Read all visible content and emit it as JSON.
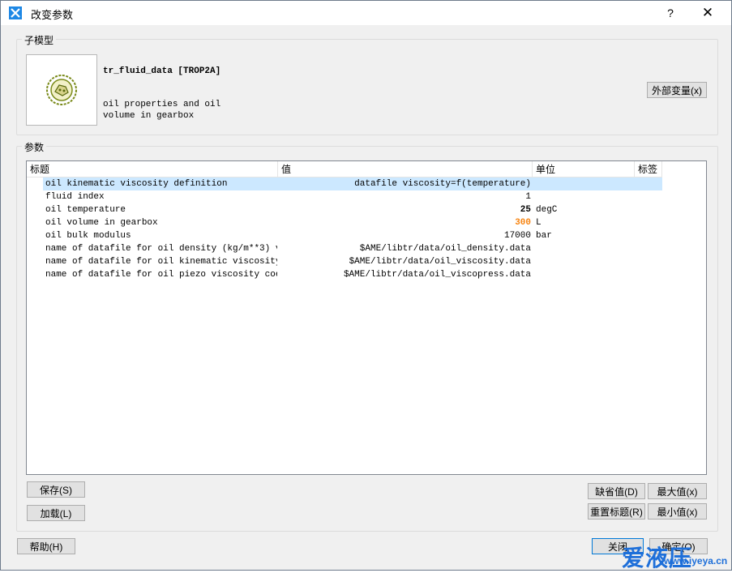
{
  "window": {
    "title": "改变参数",
    "help_glyph": "?",
    "close_glyph": "✕"
  },
  "submodel": {
    "group_label": "子模型",
    "name": "tr_fluid_data [TROP2A]",
    "description_line1": "oil properties and oil",
    "description_line2": "volume in gearbox",
    "external_vars_button": "外部变量(x)"
  },
  "params": {
    "group_label": "参数",
    "columns": [
      "标题",
      "值",
      "单位",
      "标签"
    ],
    "rows": [
      {
        "title": "oil kinematic viscosity definition",
        "value": "datafile viscosity=f(temperature)",
        "unit": ""
      },
      {
        "title": "fluid index",
        "value": "1",
        "unit": ""
      },
      {
        "title": "oil temperature",
        "value": "25",
        "unit": "degC"
      },
      {
        "title": "oil volume in gearbox",
        "value": "300",
        "unit": "L"
      },
      {
        "title": "oil bulk modulus",
        "value": "17000",
        "unit": "bar"
      },
      {
        "title": "name of datafile for oil density (kg/m**3) vs…",
        "value": "$AME/libtr/data/oil_density.data",
        "unit": ""
      },
      {
        "title": "name of datafile for oil kinematic viscosity …",
        "value": "$AME/libtr/data/oil_viscosity.data",
        "unit": ""
      },
      {
        "title": "name of datafile for oil piezo viscosity coef…",
        "value": "$AME/libtr/data/oil_viscopress.data",
        "unit": ""
      }
    ],
    "selected_row": 0
  },
  "buttons": {
    "save": "保存(S)",
    "load": "加载(L)",
    "default_value": "缺省值(D)",
    "max_value": "最大值(x)",
    "reset_title": "重置标题(R)",
    "min_value": "最小值(x)",
    "help": "帮助(H)",
    "close": "关闭",
    "ok": "确定(O)"
  },
  "watermark": {
    "brand": "爱液压",
    "url": "www.iyeya.cn"
  },
  "colors": {
    "selected_row": "#cce8ff",
    "modified_value": "#f7830f",
    "accent": "#0078d7"
  },
  "icons": {
    "app": "app-x-icon",
    "submodel": "oil-gearbox-icon"
  }
}
